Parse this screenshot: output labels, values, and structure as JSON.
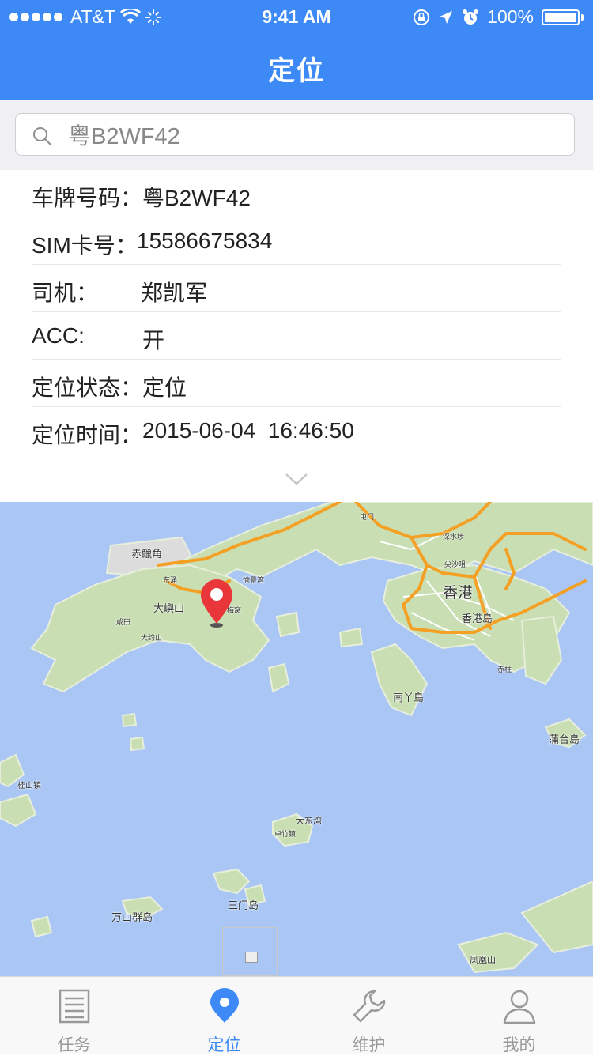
{
  "status_bar": {
    "carrier": "AT&T",
    "time": "9:41 AM",
    "battery": "100%"
  },
  "header": {
    "title": "定位"
  },
  "search": {
    "value": "粤B2WF42"
  },
  "info_rows": [
    {
      "label": "车牌号码：",
      "value": "粤B2WF42"
    },
    {
      "label": "SIM卡号：",
      "value": "15586675834"
    },
    {
      "label": "司机：",
      "value": "郑凯军"
    },
    {
      "label": "ACC:",
      "value": "开"
    },
    {
      "label": "定位状态：",
      "value": "定位"
    },
    {
      "label": "定位时间：",
      "value": "2015-06-04  16:46:50"
    }
  ],
  "map": {
    "labels": {
      "chek_lap_kok": "赤鱲角",
      "tai_yue_shan": "大嶼山",
      "hong_kong": "香港",
      "hk_island": "香港島",
      "lamma": "南丫島",
      "po_toi": "蒲台島",
      "tai_tung_wan": "大东湾",
      "soko": "三门岛",
      "wanshan": "万山群岛",
      "fenghuang": "凤凰山",
      "guishan": "桂山镇",
      "tongchong": "东涌",
      "dayushan_small": "大屿山",
      "chek_lap_small": "咸田",
      "tai_o": "大约山",
      "mui_wo": "梅窝",
      "yucheng": "愉景湾",
      "zhushan": "卓竹镇",
      "chi_ma": "赤柱",
      "jian_sha": "尖沙咀",
      "sham": "深水埗",
      "heng": "屯门"
    },
    "road_colors": {
      "highway": "#f4a024",
      "road": "#ffffff"
    },
    "marker_color": "#e8363a"
  },
  "tabbar": {
    "items": [
      {
        "label": "任务",
        "icon": "list-icon",
        "active": false
      },
      {
        "label": "定位",
        "icon": "location-pin-icon",
        "active": true
      },
      {
        "label": "维护",
        "icon": "wrench-icon",
        "active": false
      },
      {
        "label": "我的",
        "icon": "person-icon",
        "active": false
      }
    ]
  }
}
